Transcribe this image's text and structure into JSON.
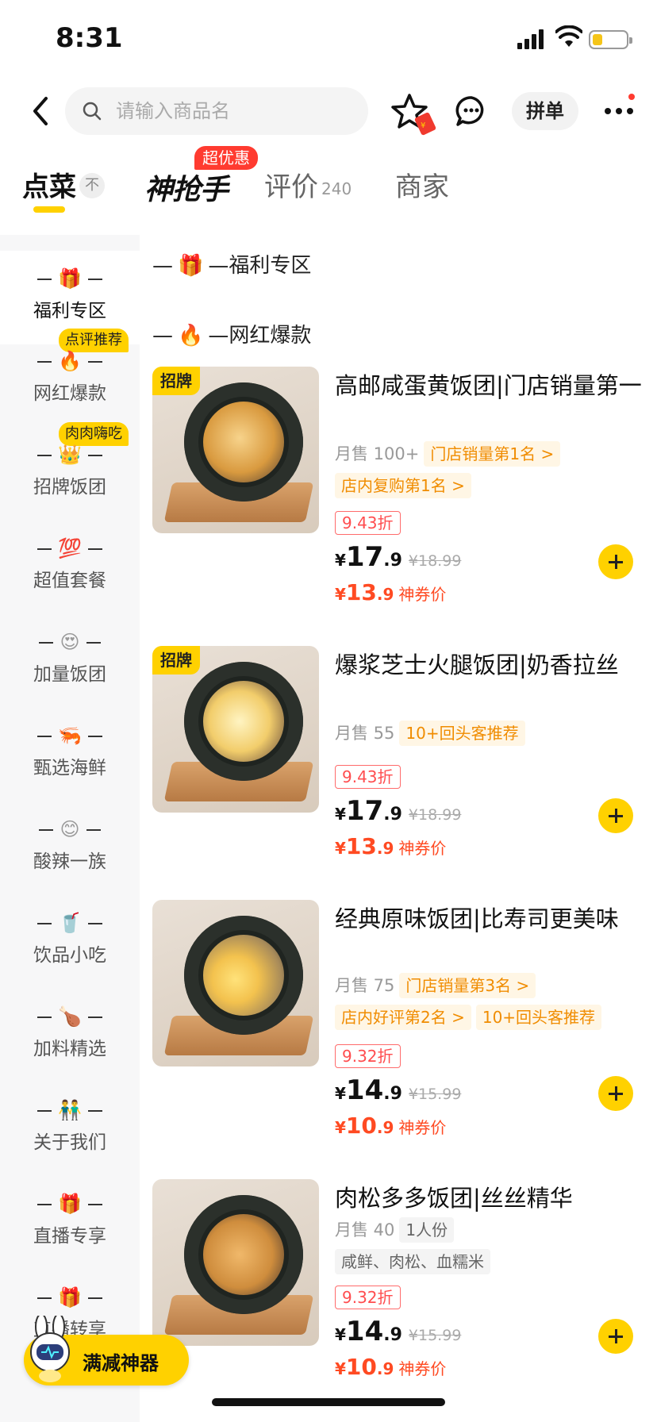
{
  "status_bar": {
    "time": "8:31"
  },
  "header": {
    "search_placeholder": "请输入商品名",
    "group_order_label": "拼单"
  },
  "tabs": {
    "order": "点菜",
    "top_icon": "不",
    "grab": "神抢手",
    "grab_badge": "超优惠",
    "review": "评价",
    "review_count": "240",
    "shop": "商家"
  },
  "sidebar": {
    "items": [
      {
        "emoji": "🎁",
        "label": "福利专区"
      },
      {
        "emoji": "🔥",
        "label": "网红爆款",
        "badge": "点评推荐"
      },
      {
        "emoji": "👑",
        "label": "招牌饭团",
        "badge": "肉肉嗨吃"
      },
      {
        "emoji": "💯",
        "label": "超值套餐"
      },
      {
        "emoji": "😍",
        "label": "加量饭团"
      },
      {
        "emoji": "🦐",
        "label": "甄选海鲜"
      },
      {
        "emoji": "😊",
        "label": "酸辣一族"
      },
      {
        "emoji": "🥤",
        "label": "饮品小吃"
      },
      {
        "emoji": "🍗",
        "label": "加料精选"
      },
      {
        "emoji": "👬",
        "label": "关于我们"
      },
      {
        "emoji": "🎁",
        "label": "直播专享"
      },
      {
        "emoji": "🎁",
        "label": "直播转享"
      }
    ]
  },
  "sections": {
    "welfare": {
      "prefix": "—",
      "emoji": "🎁",
      "title": "—福利专区"
    },
    "hot": {
      "prefix": "—",
      "emoji": "🔥",
      "title": "—网红爆款"
    }
  },
  "products": [
    {
      "tag": "招牌",
      "title": "高邮咸蛋黄饭团|门店销量第一",
      "sales": "月售 100+",
      "chips": [
        "门店销量第1名 >",
        "店内复购第1名 >"
      ],
      "discount": "9.43折",
      "price_int": "17",
      "price_dec": ".9",
      "orig": "¥18.99",
      "coupon_int": "13",
      "coupon_dec": ".9",
      "coupon_label": "神券价"
    },
    {
      "tag": "招牌",
      "title": "爆浆芝士火腿饭团|奶香拉丝",
      "sales": "月售 55",
      "chips": [
        "10+回头客推荐"
      ],
      "discount": "9.43折",
      "price_int": "17",
      "price_dec": ".9",
      "orig": "¥18.99",
      "coupon_int": "13",
      "coupon_dec": ".9",
      "coupon_label": "神券价"
    },
    {
      "title": "经典原味饭团|比寿司更美味",
      "sales": "月售 75",
      "chips": [
        "门店销量第3名 >",
        "店内好评第2名 >",
        "10+回头客推荐"
      ],
      "discount": "9.32折",
      "price_int": "14",
      "price_dec": ".9",
      "orig": "¥15.99",
      "coupon_int": "10",
      "coupon_dec": ".9",
      "coupon_label": "神券价"
    },
    {
      "title": "肉松多多饭团|丝丝精华",
      "sales": "月售 40",
      "chips": [
        "1人份",
        "咸鲜、肉松、血糯米"
      ],
      "discount": "9.32折",
      "price_int": "14",
      "price_dec": ".9",
      "orig": "¥15.99",
      "coupon_int": "10",
      "coupon_dec": ".9",
      "coupon_label": "神券价"
    }
  ],
  "currency": "¥",
  "promo": {
    "label": "满减神器"
  },
  "colors": {
    "accent": "#ffd100",
    "price_red": "#ff4a22",
    "badge_red": "#ff3b30",
    "chip_orange": "#f08c00"
  }
}
